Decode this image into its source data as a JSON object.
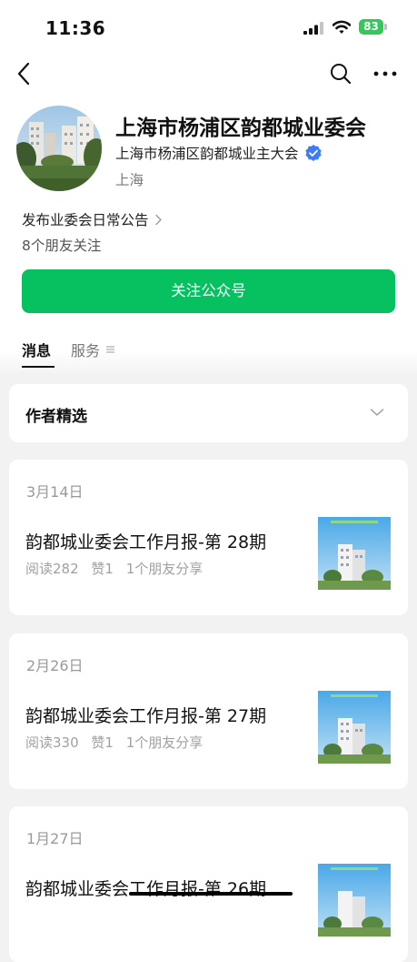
{
  "status_bar": {
    "time": "11:36",
    "battery": "83"
  },
  "profile": {
    "name": "上海市杨浦区韵都城业委会",
    "owner": "上海市杨浦区韵都城业主大会",
    "location": "上海",
    "description": "发布业委会日常公告",
    "friends_following": "8个朋友关注",
    "follow_button": "关注公众号"
  },
  "tabs": {
    "messages": "消息",
    "services": "服务"
  },
  "author_selection": "作者精选",
  "messages": [
    {
      "date": "3月14日",
      "title": "韵都城业委会工作月报-第 28期",
      "reads": "阅读282",
      "likes": "赞1",
      "shares": "1个朋友分享"
    },
    {
      "date": "2月26日",
      "title": "韵都城业委会工作月报-第 27期",
      "reads": "阅读330",
      "likes": "赞1",
      "shares": "1个朋友分享"
    },
    {
      "date": "1月27日",
      "title": "韵都城业委会工作月报-第 26期"
    }
  ],
  "colors": {
    "accent": "#07c160",
    "verified": "#3d7bf7",
    "battery": "#34c759"
  }
}
